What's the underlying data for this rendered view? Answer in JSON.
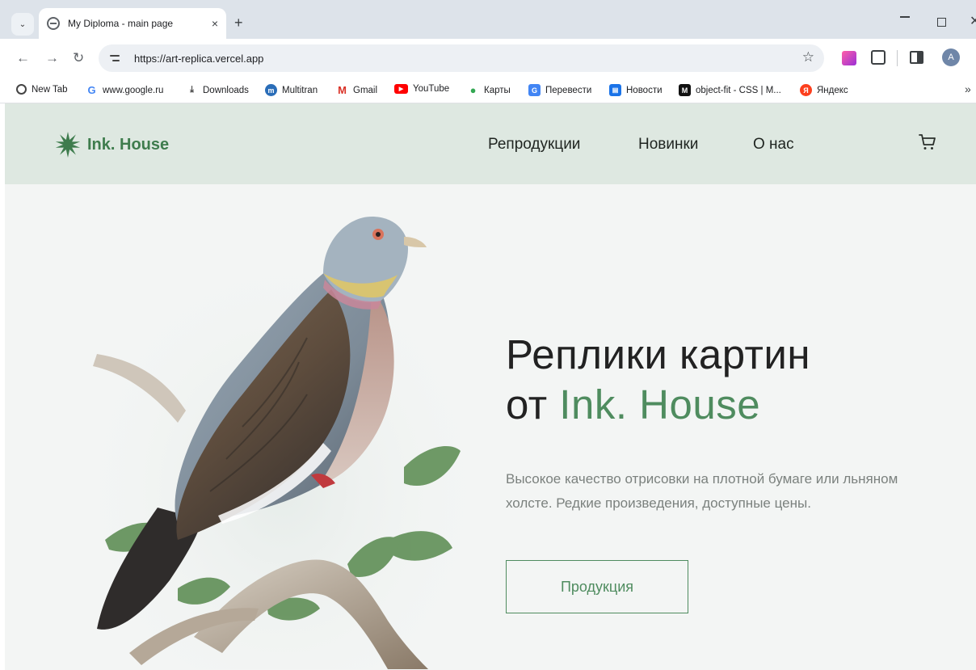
{
  "browser": {
    "tab_title": "My Diploma - main page",
    "tab_close": "×",
    "new_tab": "+",
    "url": "https://art-replica.vercel.app",
    "avatar_letter": "A",
    "bookmarks": [
      {
        "label": "New Tab",
        "icon": "globe-icon"
      },
      {
        "label": "www.google.ru",
        "icon": "google-icon"
      },
      {
        "label": "Downloads",
        "icon": "download-icon"
      },
      {
        "label": "Multitran",
        "icon": "multitran-icon"
      },
      {
        "label": "Gmail",
        "icon": "gmail-icon"
      },
      {
        "label": "YouTube",
        "icon": "youtube-icon"
      },
      {
        "label": "Карты",
        "icon": "maps-icon"
      },
      {
        "label": "Перевести",
        "icon": "translate-icon"
      },
      {
        "label": "Новости",
        "icon": "news-icon"
      },
      {
        "label": "object-fit - CSS | M...",
        "icon": "mdn-icon"
      },
      {
        "label": "Яндекс",
        "icon": "yandex-icon"
      }
    ],
    "more_bookmarks": "»"
  },
  "site": {
    "logo_text": "Ink. House",
    "nav": [
      "Репродукции",
      "Новинки",
      "О нас"
    ],
    "hero": {
      "title_line1": "Реплики картин",
      "title_line2_prefix": "от ",
      "title_line2_accent": "Ink. House",
      "subtitle": "Высокое качество отрисовки на плотной бумаге или льняном холсте. Редкие произведения, доступные цены.",
      "cta_label": "Продукция"
    },
    "colors": {
      "accent": "#4f8c5f",
      "header_bg": "#dee8e1",
      "hero_bg": "#f3f5f4"
    }
  }
}
